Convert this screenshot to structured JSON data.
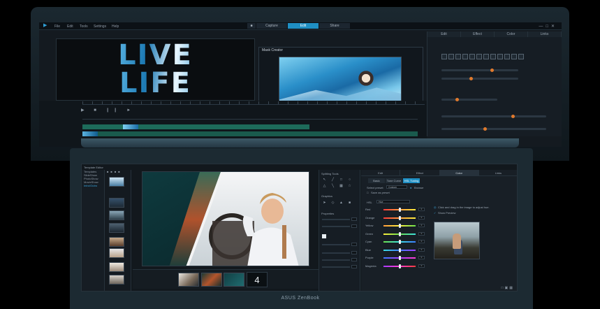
{
  "top_app": {
    "menu": [
      "File",
      "Edit",
      "Tools",
      "Settings",
      "Help"
    ],
    "tabs": [
      {
        "label": "Capture",
        "active": false
      },
      {
        "label": "Edit",
        "active": true
      },
      {
        "label": "Share",
        "active": false
      }
    ],
    "preview_title_line1": "LIVE",
    "preview_title_line2": "LIFE",
    "mask_window_title": "Mask Creator",
    "right_tabs": [
      "Edit",
      "Effect",
      "Color",
      "Links"
    ]
  },
  "bottom_app": {
    "title": "Template Editor",
    "left_list": [
      "Templates",
      "SlideShow",
      "PhotoShow",
      "MovieShow",
      "Intro/Outro"
    ],
    "strip_page": "4",
    "tools_labels": [
      "Splitting Tools",
      "Graphics",
      "Properties"
    ],
    "color_tabs": [
      {
        "label": "Edit",
        "active": false
      },
      {
        "label": "Effect",
        "active": false
      },
      {
        "label": "Color",
        "active": true
      },
      {
        "label": "Links",
        "active": false
      }
    ],
    "color_subtabs": [
      {
        "label": "Basic",
        "active": false
      },
      {
        "label": "Tone Curve",
        "active": false
      },
      {
        "label": "HSL Tuning",
        "active": true
      }
    ],
    "select_preset_label": "Select preset:",
    "preset_value": "Custom",
    "browse_label": "Browse",
    "save_preset_label": "Save as preset",
    "hsl_label": "HSL",
    "hsl_mode": "Hue",
    "click_hint": "Click and drag in the image to adjust hue.",
    "show_preview_label": "Show Preview",
    "hsl_rows": [
      {
        "label": "Red",
        "value": "0",
        "knob": 0.5
      },
      {
        "label": "Orange",
        "value": "0",
        "knob": 0.5
      },
      {
        "label": "Yellow",
        "value": "0",
        "knob": 0.5
      },
      {
        "label": "Green",
        "value": "0",
        "knob": 0.5
      },
      {
        "label": "Cyan",
        "value": "0",
        "knob": 0.5
      },
      {
        "label": "Blue",
        "value": "0",
        "knob": 0.5
      },
      {
        "label": "Purple",
        "value": "0",
        "knob": 0.5
      },
      {
        "label": "Magenta",
        "value": "0",
        "knob": 0.5
      }
    ]
  },
  "brand": "ASUS ZenBook",
  "colors": {
    "accent": "#1f8fc4",
    "track_green": "#1d6b5a",
    "panel_bg": "#12181d"
  }
}
